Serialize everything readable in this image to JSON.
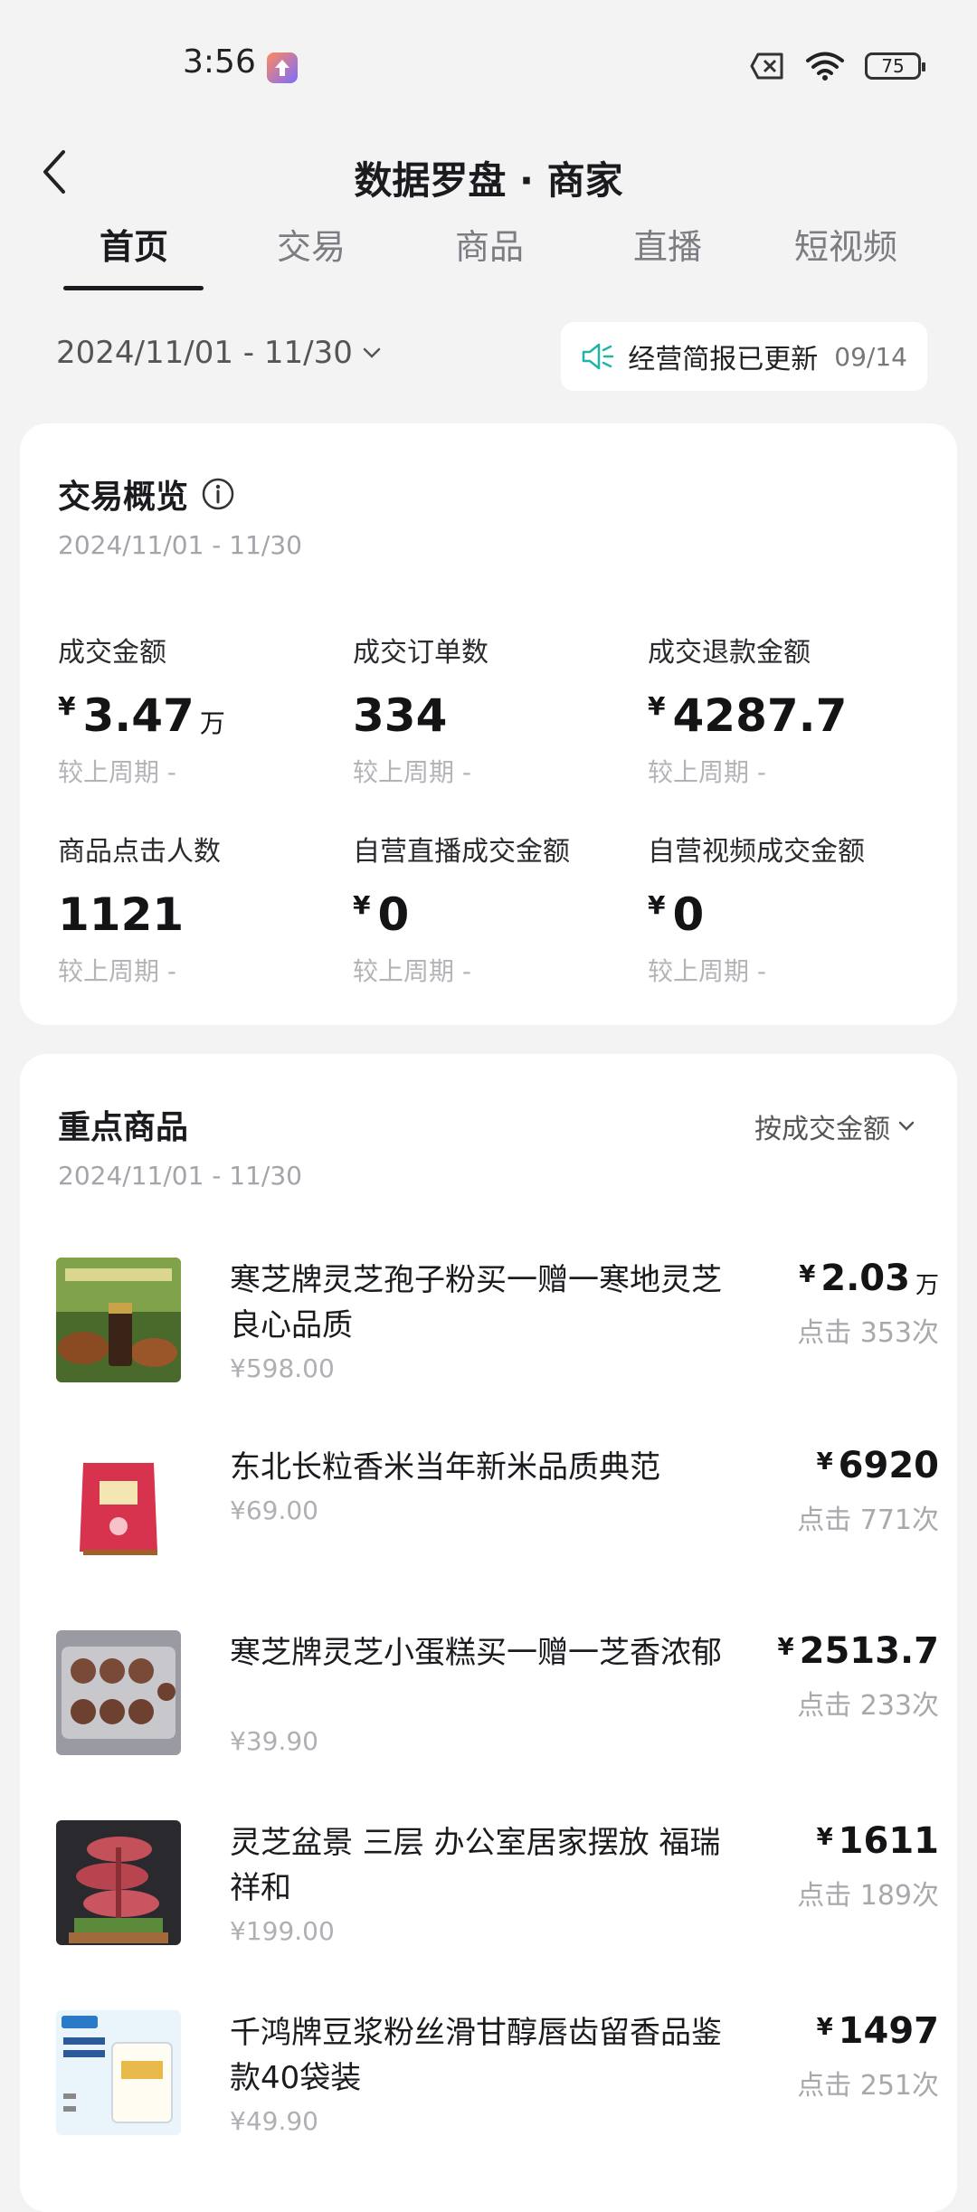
{
  "status_bar": {
    "time": "3:56",
    "battery": "75"
  },
  "nav": {
    "title": "数据罗盘 · 商家"
  },
  "tabs": [
    "首页",
    "交易",
    "商品",
    "直播",
    "短视频"
  ],
  "date_range": "2024/11/01 - 11/30",
  "report": {
    "label": "经营简报已更新",
    "date": "09/14"
  },
  "overview": {
    "title": "交易概览",
    "date": "2024/11/01 - 11/30",
    "metrics": [
      {
        "label": "成交金额",
        "yen": "¥",
        "value": "3.47",
        "unit": "万",
        "compare": "较上周期 -"
      },
      {
        "label": "成交订单数",
        "yen": "",
        "value": "334",
        "unit": "",
        "compare": "较上周期 -"
      },
      {
        "label": "成交退款金额",
        "yen": "¥",
        "value": "4287.7",
        "unit": "",
        "compare": "较上周期 -"
      },
      {
        "label": "商品点击人数",
        "yen": "",
        "value": "1121",
        "unit": "",
        "compare": "较上周期 -"
      },
      {
        "label": "自营直播成交金额",
        "yen": "¥",
        "value": "0",
        "unit": "",
        "compare": "较上周期 -"
      },
      {
        "label": "自营视频成交金额",
        "yen": "¥",
        "value": "0",
        "unit": "",
        "compare": "较上周期 -"
      }
    ]
  },
  "products": {
    "title": "重点商品",
    "date": "2024/11/01 - 11/30",
    "sort_label": "按成交金额",
    "items": [
      {
        "name": "寒芝牌灵芝孢子粉买一赠一寒地灵芝良心品质",
        "price": "¥598.00",
        "yen": "¥",
        "amount": "2.03",
        "unit": "万",
        "clicks": "点击 353次"
      },
      {
        "name": "东北长粒香米当年新米品质典范",
        "price": "¥69.00",
        "yen": "¥",
        "amount": "6920",
        "unit": "",
        "clicks": "点击 771次"
      },
      {
        "name": "寒芝牌灵芝小蛋糕买一赠一芝香浓郁",
        "price": "¥39.90",
        "yen": "¥",
        "amount": "2513.7",
        "unit": "",
        "clicks": "点击 233次"
      },
      {
        "name": "灵芝盆景 三层 办公室居家摆放 福瑞祥和",
        "price": "¥199.00",
        "yen": "¥",
        "amount": "1611",
        "unit": "",
        "clicks": "点击 189次"
      },
      {
        "name": "千鸿牌豆浆粉丝滑甘醇唇齿留香品鉴款40袋装",
        "price": "¥49.90",
        "yen": "¥",
        "amount": "1497",
        "unit": "",
        "clicks": "点击 251次"
      }
    ]
  },
  "icons": [
    "back-arrow-icon",
    "speaker-icon",
    "info-icon",
    "chevron-down-icon",
    "wifi-icon",
    "no-sim-icon",
    "battery-icon"
  ],
  "colors": {
    "accent_teal": "#1fb5a6",
    "background": "#f3f3f4",
    "card": "#ffffff"
  }
}
